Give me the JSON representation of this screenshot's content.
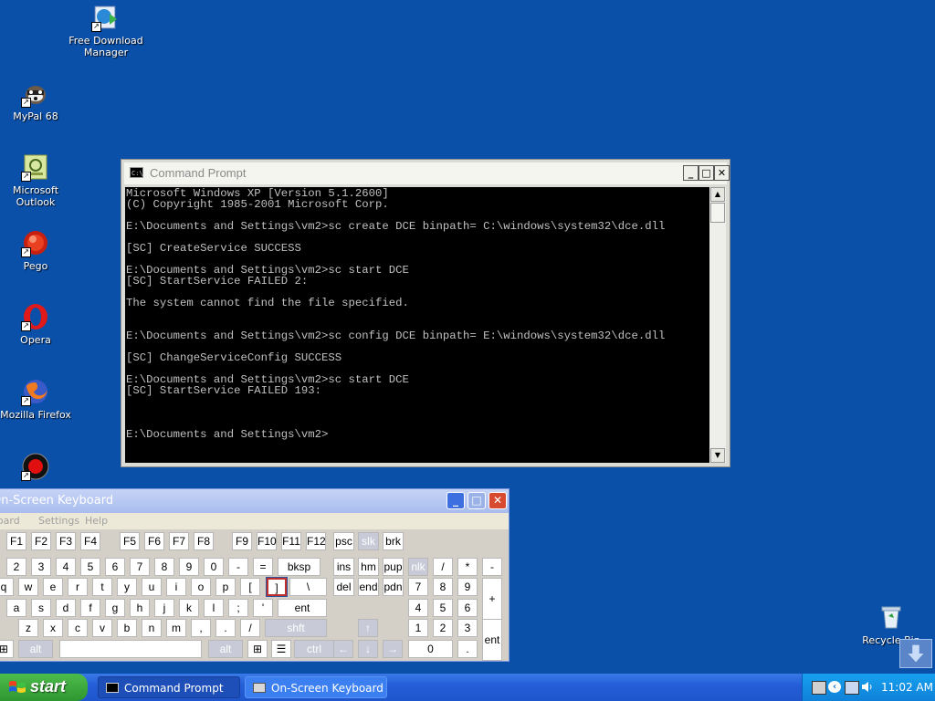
{
  "desktop": {
    "icons": [
      {
        "label_line1": "Free Download",
        "label_line2": "Manager",
        "icon": "fdm-icon"
      },
      {
        "label_line1": "MyPal 68",
        "label_line2": "",
        "icon": "mypal-icon"
      },
      {
        "label_line1": "Microsoft",
        "label_line2": "Outlook",
        "icon": "outlook-icon"
      },
      {
        "label_line1": "Pego",
        "label_line2": "",
        "icon": "pego-icon"
      },
      {
        "label_line1": "Opera",
        "label_line2": "",
        "icon": "opera-icon"
      },
      {
        "label_line1": "Mozilla Firefox",
        "label_line2": "",
        "icon": "firefox-icon"
      }
    ],
    "recycle_bin": {
      "label": "Recycle Bin",
      "icon": "recycle-bin-icon"
    }
  },
  "cmd_window": {
    "title": "Command Prompt",
    "icon_text": "C:\\",
    "buttons": {
      "minimize": "_",
      "maximize": "□",
      "close": "✕"
    },
    "output": "Microsoft Windows XP [Version 5.1.2600]\n(C) Copyright 1985-2001 Microsoft Corp.\n\nE:\\Documents and Settings\\vm2>sc create DCE binpath= C:\\windows\\system32\\dce.dll\n\n[SC] CreateService SUCCESS\n\nE:\\Documents and Settings\\vm2>sc start DCE\n[SC] StartService FAILED 2:\n\nThe system cannot find the file specified.\n\n\nE:\\Documents and Settings\\vm2>sc config DCE binpath= E:\\windows\\system32\\dce.dll\n\n[SC] ChangeServiceConfig SUCCESS\n\nE:\\Documents and Settings\\vm2>sc start DCE\n[SC] StartService FAILED 193:\n\n\n\nE:\\Documents and Settings\\vm2>",
    "scroll_up": "▲",
    "scroll_down": "▼"
  },
  "osk": {
    "title": "On-Screen Keyboard",
    "menu": [
      "Keyboard",
      "Settings",
      "Help"
    ],
    "buttons": {
      "minimize": "_",
      "maximize": "□",
      "close": "✕"
    },
    "rows": [
      [
        {
          "l": "F1"
        },
        {
          "l": "F2"
        },
        {
          "l": "F3"
        },
        {
          "l": "F4"
        },
        {
          "l": "F5"
        },
        {
          "l": "F6"
        },
        {
          "l": "F7"
        },
        {
          "l": "F8"
        },
        {
          "l": "F9"
        },
        {
          "l": "F10"
        },
        {
          "l": "F11"
        },
        {
          "l": "F12"
        },
        {
          "l": "psc"
        },
        {
          "l": "slk",
          "dim": true
        },
        {
          "l": "brk"
        }
      ],
      [
        {
          "l": "2"
        },
        {
          "l": "3"
        },
        {
          "l": "4"
        },
        {
          "l": "5"
        },
        {
          "l": "6"
        },
        {
          "l": "7"
        },
        {
          "l": "8"
        },
        {
          "l": "9"
        },
        {
          "l": "0"
        },
        {
          "l": "-"
        },
        {
          "l": "="
        },
        {
          "l": "bksp"
        },
        {
          "l": "ins"
        },
        {
          "l": "hm"
        },
        {
          "l": "pup"
        },
        {
          "l": "nlk",
          "dim": true
        },
        {
          "l": "/"
        },
        {
          "l": "*"
        },
        {
          "l": "-"
        }
      ],
      [
        {
          "l": "q"
        },
        {
          "l": "w"
        },
        {
          "l": "e"
        },
        {
          "l": "r"
        },
        {
          "l": "t"
        },
        {
          "l": "y"
        },
        {
          "l": "u"
        },
        {
          "l": "i"
        },
        {
          "l": "o"
        },
        {
          "l": "p"
        },
        {
          "l": "["
        },
        {
          "l": "]",
          "sel": true
        },
        {
          "l": "\\"
        },
        {
          "l": "del"
        },
        {
          "l": "end"
        },
        {
          "l": "pdn"
        },
        {
          "l": "7"
        },
        {
          "l": "8"
        },
        {
          "l": "9"
        },
        {
          "l": "+"
        }
      ],
      [
        {
          "l": "a"
        },
        {
          "l": "s"
        },
        {
          "l": "d"
        },
        {
          "l": "f"
        },
        {
          "l": "g"
        },
        {
          "l": "h"
        },
        {
          "l": "j"
        },
        {
          "l": "k"
        },
        {
          "l": "l"
        },
        {
          "l": ";"
        },
        {
          "l": "'"
        },
        {
          "l": "ent"
        },
        {
          "l": "4"
        },
        {
          "l": "5"
        },
        {
          "l": "6"
        }
      ],
      [
        {
          "l": "z"
        },
        {
          "l": "x"
        },
        {
          "l": "c"
        },
        {
          "l": "v"
        },
        {
          "l": "b"
        },
        {
          "l": "n"
        },
        {
          "l": "m"
        },
        {
          "l": ","
        },
        {
          "l": "."
        },
        {
          "l": "/"
        },
        {
          "l": "shft",
          "dim": true
        },
        {
          "l": "↑",
          "dim": true
        },
        {
          "l": "1"
        },
        {
          "l": "2"
        },
        {
          "l": "3"
        },
        {
          "l": "ent"
        }
      ],
      [
        {
          "l": "⊞"
        },
        {
          "l": "alt",
          "dim": true
        },
        {
          "l": ""
        },
        {
          "l": "alt",
          "dim": true
        },
        {
          "l": "⊞"
        },
        {
          "l": "☰"
        },
        {
          "l": "ctrl",
          "dim": true
        },
        {
          "l": "←",
          "dim": true
        },
        {
          "l": "↓",
          "dim": true
        },
        {
          "l": "→",
          "dim": true
        },
        {
          "l": "0"
        },
        {
          "l": "."
        }
      ]
    ]
  },
  "taskbar": {
    "start_label": "start",
    "tasks": [
      {
        "label": "Command Prompt",
        "icon": "cmd-icon"
      },
      {
        "label": "On-Screen Keyboard",
        "icon": "keyboard-icon"
      }
    ],
    "clock": "11:02 AM"
  },
  "colors": {
    "desktop": "#0a4fa8",
    "taskbar": "#245ed8",
    "start_button": "#3aa83a",
    "tray": "#0f82d8",
    "console_text": "#c0c0c0"
  }
}
